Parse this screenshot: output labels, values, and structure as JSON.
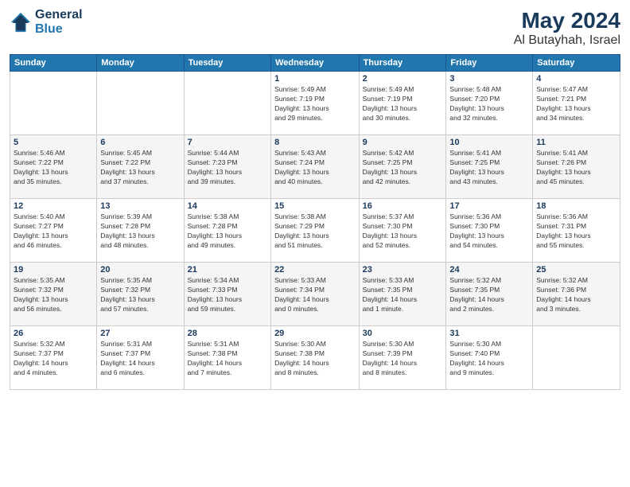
{
  "header": {
    "logo_line1": "General",
    "logo_line2": "Blue",
    "month": "May 2024",
    "location": "Al Butayhah, Israel"
  },
  "days_of_week": [
    "Sunday",
    "Monday",
    "Tuesday",
    "Wednesday",
    "Thursday",
    "Friday",
    "Saturday"
  ],
  "weeks": [
    [
      {
        "day": "",
        "info": ""
      },
      {
        "day": "",
        "info": ""
      },
      {
        "day": "",
        "info": ""
      },
      {
        "day": "1",
        "info": "Sunrise: 5:49 AM\nSunset: 7:19 PM\nDaylight: 13 hours\nand 29 minutes."
      },
      {
        "day": "2",
        "info": "Sunrise: 5:49 AM\nSunset: 7:19 PM\nDaylight: 13 hours\nand 30 minutes."
      },
      {
        "day": "3",
        "info": "Sunrise: 5:48 AM\nSunset: 7:20 PM\nDaylight: 13 hours\nand 32 minutes."
      },
      {
        "day": "4",
        "info": "Sunrise: 5:47 AM\nSunset: 7:21 PM\nDaylight: 13 hours\nand 34 minutes."
      }
    ],
    [
      {
        "day": "5",
        "info": "Sunrise: 5:46 AM\nSunset: 7:22 PM\nDaylight: 13 hours\nand 35 minutes."
      },
      {
        "day": "6",
        "info": "Sunrise: 5:45 AM\nSunset: 7:22 PM\nDaylight: 13 hours\nand 37 minutes."
      },
      {
        "day": "7",
        "info": "Sunrise: 5:44 AM\nSunset: 7:23 PM\nDaylight: 13 hours\nand 39 minutes."
      },
      {
        "day": "8",
        "info": "Sunrise: 5:43 AM\nSunset: 7:24 PM\nDaylight: 13 hours\nand 40 minutes."
      },
      {
        "day": "9",
        "info": "Sunrise: 5:42 AM\nSunset: 7:25 PM\nDaylight: 13 hours\nand 42 minutes."
      },
      {
        "day": "10",
        "info": "Sunrise: 5:41 AM\nSunset: 7:25 PM\nDaylight: 13 hours\nand 43 minutes."
      },
      {
        "day": "11",
        "info": "Sunrise: 5:41 AM\nSunset: 7:26 PM\nDaylight: 13 hours\nand 45 minutes."
      }
    ],
    [
      {
        "day": "12",
        "info": "Sunrise: 5:40 AM\nSunset: 7:27 PM\nDaylight: 13 hours\nand 46 minutes."
      },
      {
        "day": "13",
        "info": "Sunrise: 5:39 AM\nSunset: 7:28 PM\nDaylight: 13 hours\nand 48 minutes."
      },
      {
        "day": "14",
        "info": "Sunrise: 5:38 AM\nSunset: 7:28 PM\nDaylight: 13 hours\nand 49 minutes."
      },
      {
        "day": "15",
        "info": "Sunrise: 5:38 AM\nSunset: 7:29 PM\nDaylight: 13 hours\nand 51 minutes."
      },
      {
        "day": "16",
        "info": "Sunrise: 5:37 AM\nSunset: 7:30 PM\nDaylight: 13 hours\nand 52 minutes."
      },
      {
        "day": "17",
        "info": "Sunrise: 5:36 AM\nSunset: 7:30 PM\nDaylight: 13 hours\nand 54 minutes."
      },
      {
        "day": "18",
        "info": "Sunrise: 5:36 AM\nSunset: 7:31 PM\nDaylight: 13 hours\nand 55 minutes."
      }
    ],
    [
      {
        "day": "19",
        "info": "Sunrise: 5:35 AM\nSunset: 7:32 PM\nDaylight: 13 hours\nand 56 minutes."
      },
      {
        "day": "20",
        "info": "Sunrise: 5:35 AM\nSunset: 7:32 PM\nDaylight: 13 hours\nand 57 minutes."
      },
      {
        "day": "21",
        "info": "Sunrise: 5:34 AM\nSunset: 7:33 PM\nDaylight: 13 hours\nand 59 minutes."
      },
      {
        "day": "22",
        "info": "Sunrise: 5:33 AM\nSunset: 7:34 PM\nDaylight: 14 hours\nand 0 minutes."
      },
      {
        "day": "23",
        "info": "Sunrise: 5:33 AM\nSunset: 7:35 PM\nDaylight: 14 hours\nand 1 minute."
      },
      {
        "day": "24",
        "info": "Sunrise: 5:32 AM\nSunset: 7:35 PM\nDaylight: 14 hours\nand 2 minutes."
      },
      {
        "day": "25",
        "info": "Sunrise: 5:32 AM\nSunset: 7:36 PM\nDaylight: 14 hours\nand 3 minutes."
      }
    ],
    [
      {
        "day": "26",
        "info": "Sunrise: 5:32 AM\nSunset: 7:37 PM\nDaylight: 14 hours\nand 4 minutes."
      },
      {
        "day": "27",
        "info": "Sunrise: 5:31 AM\nSunset: 7:37 PM\nDaylight: 14 hours\nand 6 minutes."
      },
      {
        "day": "28",
        "info": "Sunrise: 5:31 AM\nSunset: 7:38 PM\nDaylight: 14 hours\nand 7 minutes."
      },
      {
        "day": "29",
        "info": "Sunrise: 5:30 AM\nSunset: 7:38 PM\nDaylight: 14 hours\nand 8 minutes."
      },
      {
        "day": "30",
        "info": "Sunrise: 5:30 AM\nSunset: 7:39 PM\nDaylight: 14 hours\nand 8 minutes."
      },
      {
        "day": "31",
        "info": "Sunrise: 5:30 AM\nSunset: 7:40 PM\nDaylight: 14 hours\nand 9 minutes."
      },
      {
        "day": "",
        "info": ""
      }
    ]
  ]
}
